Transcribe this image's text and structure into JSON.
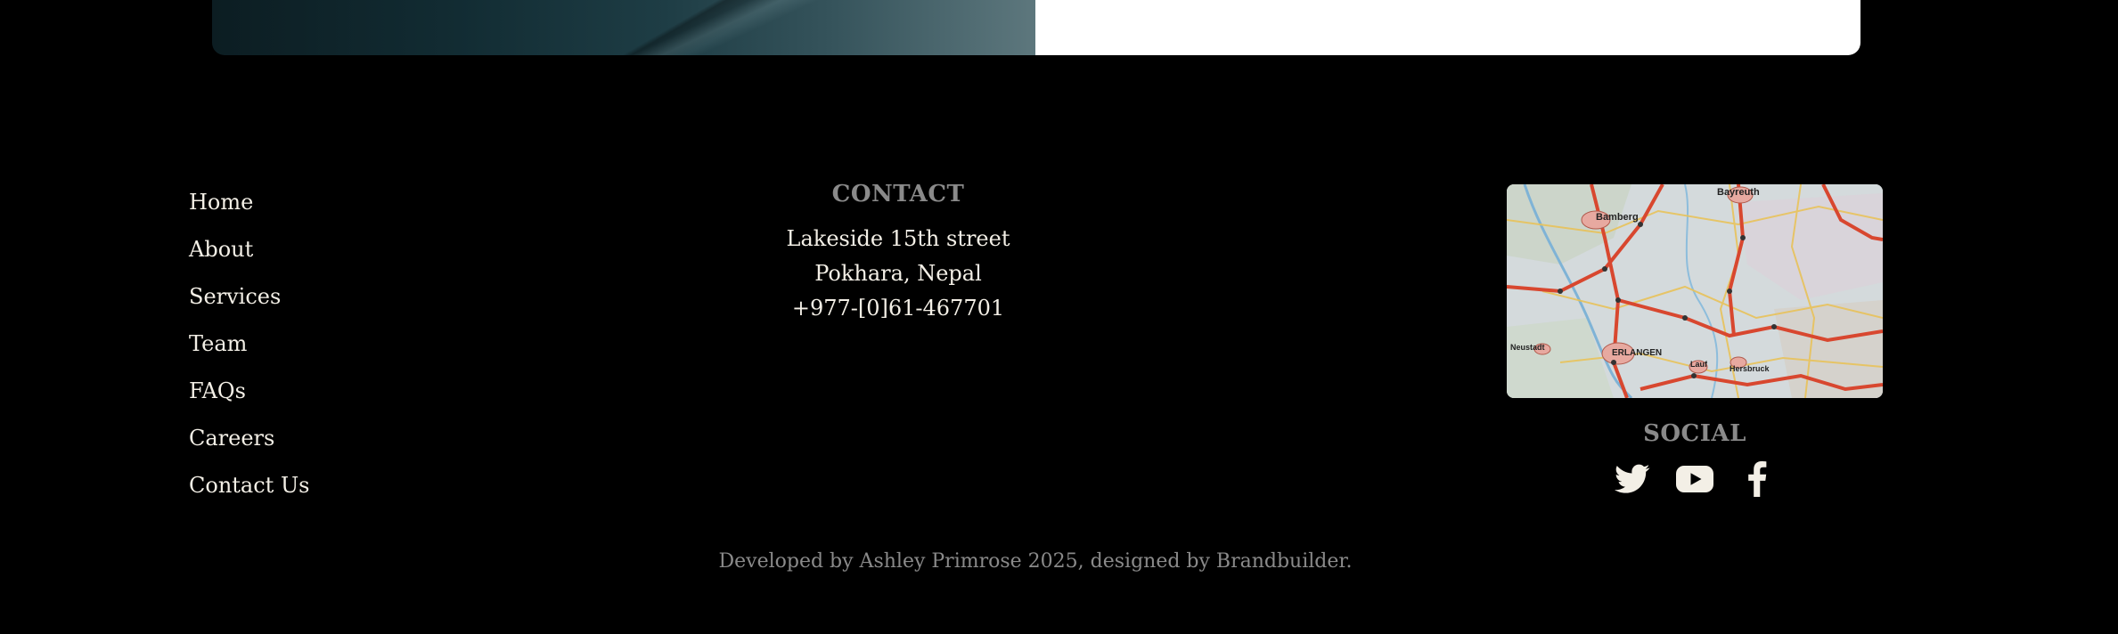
{
  "nav": {
    "items": [
      "Home",
      "About",
      "Services",
      "Team",
      "FAQs",
      "Careers",
      "Contact Us"
    ]
  },
  "contact": {
    "heading": "CONTACT",
    "address_line1": "Lakeside 15th street",
    "address_line2": "Pokhara, Nepal",
    "phone": "+977-[0]61-467701"
  },
  "map": {
    "labels": [
      "Bamberg",
      "Bayreuth",
      "ERLANGEN",
      "Neustadt",
      "Lauf",
      "Hersbruck"
    ]
  },
  "social": {
    "heading": "SOCIAL",
    "icons": [
      "twitter-icon",
      "youtube-icon",
      "facebook-icon"
    ]
  },
  "footer": {
    "credit": "Developed by Ashley Primrose 2025, designed by Brandbuilder."
  },
  "colors": {
    "background": "#000000",
    "text": "#f3efe6",
    "muted": "#8a8a8a"
  }
}
